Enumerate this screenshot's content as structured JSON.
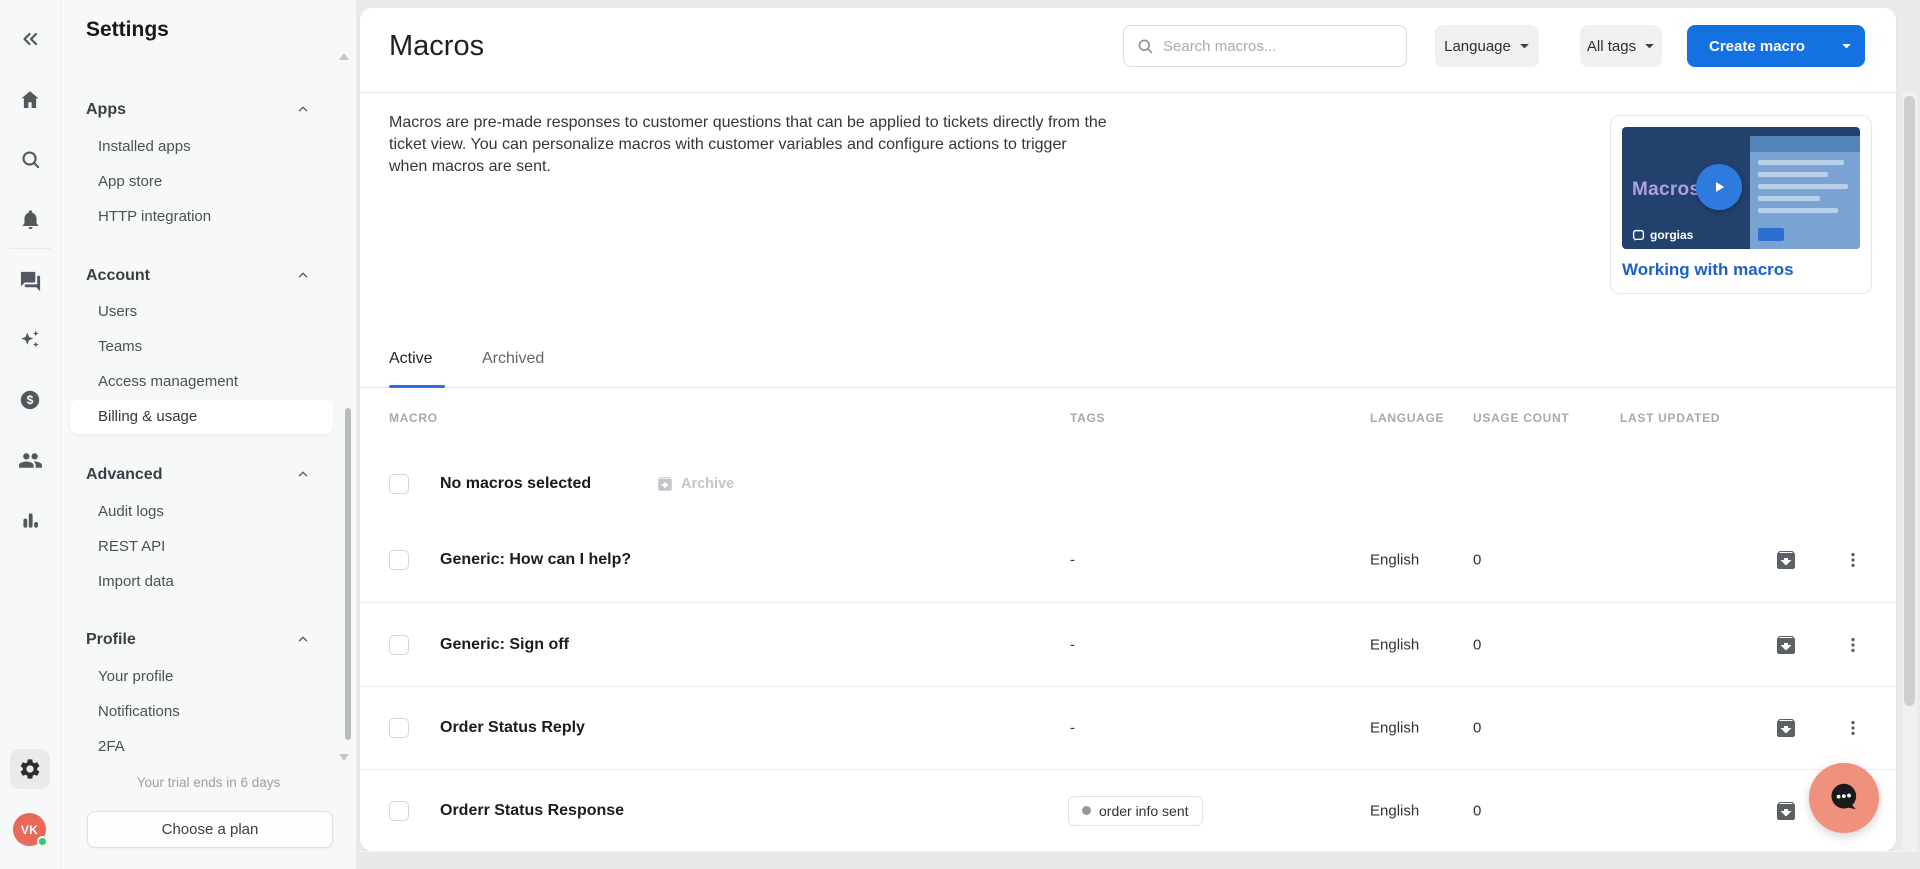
{
  "rail": {
    "avatar_initials": "VK",
    "icons": [
      "collapse-sidebar",
      "home",
      "search",
      "notifications",
      "conversations",
      "ai-assist",
      "billing",
      "customers",
      "statistics",
      "settings",
      "avatar"
    ]
  },
  "sidebar": {
    "title": "Settings",
    "sections": [
      {
        "label": "Apps",
        "items": [
          {
            "label": "Installed apps"
          },
          {
            "label": "App store"
          },
          {
            "label": "HTTP integration"
          }
        ]
      },
      {
        "label": "Account",
        "items": [
          {
            "label": "Users"
          },
          {
            "label": "Teams"
          },
          {
            "label": "Access management"
          },
          {
            "label": "Billing & usage",
            "selected": true
          }
        ]
      },
      {
        "label": "Advanced",
        "items": [
          {
            "label": "Audit logs"
          },
          {
            "label": "REST API"
          },
          {
            "label": "Import data"
          }
        ]
      },
      {
        "label": "Profile",
        "items": [
          {
            "label": "Your profile"
          },
          {
            "label": "Notifications"
          },
          {
            "label": "2FA"
          }
        ]
      }
    ],
    "trial_note": "Your trial ends in 6 days",
    "choose_plan_label": "Choose a plan"
  },
  "header": {
    "title": "Macros",
    "search_placeholder": "Search macros...",
    "search_value": "",
    "language_button": "Language",
    "tags_button": "All tags",
    "create_button": "Create macro"
  },
  "intro": {
    "description": "Macros are pre-made responses to customer questions that can be applied to tickets directly from the ticket view. You can personalize macros with customer variables and configure actions to trigger when macros are sent.",
    "video": {
      "thumbnail_title": "Macros",
      "brand": "gorgias",
      "link_label": "Working with macros"
    }
  },
  "tabs": [
    {
      "label": "Active",
      "active": true
    },
    {
      "label": "Archived",
      "active": false
    }
  ],
  "table": {
    "columns": [
      "MACRO",
      "TAGS",
      "LANGUAGE",
      "USAGE COUNT",
      "LAST UPDATED"
    ],
    "selection_bar": {
      "label": "No macros selected",
      "archive_label": "Archive"
    },
    "rows": [
      {
        "name": "Generic: How can I help?",
        "tags": "-",
        "language": "English",
        "usage_count": "0",
        "last_updated": ""
      },
      {
        "name": "Generic: Sign off",
        "tags": "-",
        "language": "English",
        "usage_count": "0",
        "last_updated": ""
      },
      {
        "name": "Order Status Reply",
        "tags": "-",
        "language": "English",
        "usage_count": "0",
        "last_updated": ""
      },
      {
        "name": "Orderr Status Response",
        "tag": "order info sent",
        "language": "English",
        "usage_count": "0",
        "last_updated": ""
      }
    ]
  },
  "colors": {
    "accent_blue": "#1371e2",
    "link_blue": "#1b61c6",
    "tab_underline": "#2d6fe0",
    "avatar_bg": "#e8685a",
    "online_dot": "#2fcc71",
    "chat_fab": "#f0917e",
    "video_navy": "#22416d",
    "sidebar_bg": "#f7f8f8"
  }
}
